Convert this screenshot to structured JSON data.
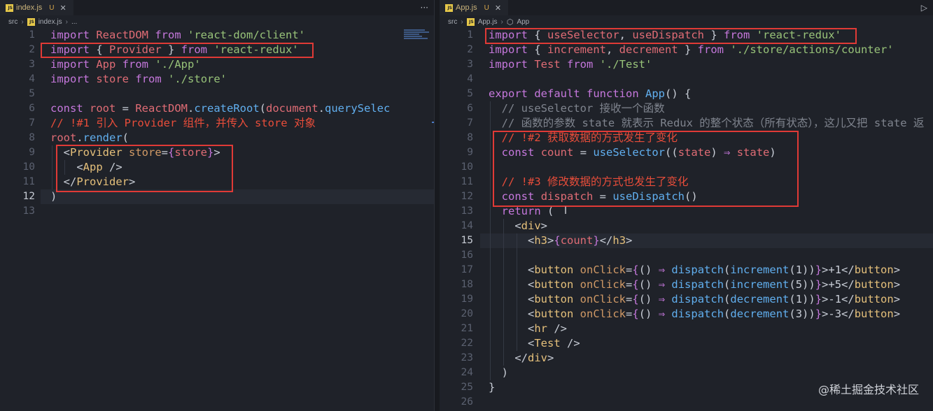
{
  "colors": {
    "kw": "#c678dd",
    "import_kw": "#c678dd",
    "id": "#e06c75",
    "str": "#98c379",
    "fn": "#61afef",
    "tag": "#e5c07b",
    "attr": "#d19a66",
    "comment": "#7f848e",
    "comment_cn": "#e84d3a",
    "punct": "#c8cdd6",
    "plain": "#c8cdd6",
    "var": "#e06c75"
  },
  "left": {
    "tab": {
      "icon": "js-icon",
      "filename": "index.js",
      "status": "U"
    },
    "more_label": "···",
    "breadcrumb": [
      "src",
      "index.js",
      "..."
    ],
    "active_line": 12,
    "lines": [
      {
        "n": "1",
        "tokens": [
          [
            "kw",
            "import"
          ],
          [
            "plain",
            " "
          ],
          [
            "id",
            "ReactDOM"
          ],
          [
            "plain",
            " "
          ],
          [
            "kw",
            "from"
          ],
          [
            "plain",
            " "
          ],
          [
            "str",
            "'react-dom/client'"
          ]
        ]
      },
      {
        "n": "2",
        "tokens": [
          [
            "kw",
            "import"
          ],
          [
            "plain",
            " { "
          ],
          [
            "id",
            "Provider"
          ],
          [
            "plain",
            " } "
          ],
          [
            "kw",
            "from"
          ],
          [
            "plain",
            " "
          ],
          [
            "str",
            "'react-redux'"
          ]
        ]
      },
      {
        "n": "3",
        "tokens": [
          [
            "kw",
            "import"
          ],
          [
            "plain",
            " "
          ],
          [
            "id",
            "App"
          ],
          [
            "plain",
            " "
          ],
          [
            "kw",
            "from"
          ],
          [
            "plain",
            " "
          ],
          [
            "str",
            "'./App'"
          ]
        ]
      },
      {
        "n": "4",
        "tokens": [
          [
            "kw",
            "import"
          ],
          [
            "plain",
            " "
          ],
          [
            "id",
            "store"
          ],
          [
            "plain",
            " "
          ],
          [
            "kw",
            "from"
          ],
          [
            "plain",
            " "
          ],
          [
            "str",
            "'./store'"
          ]
        ]
      },
      {
        "n": "5",
        "tokens": []
      },
      {
        "n": "6",
        "tokens": [
          [
            "kw",
            "const"
          ],
          [
            "plain",
            " "
          ],
          [
            "id",
            "root"
          ],
          [
            "plain",
            " = "
          ],
          [
            "id",
            "ReactDOM"
          ],
          [
            "plain",
            "."
          ],
          [
            "fn",
            "createRoot"
          ],
          [
            "plain",
            "("
          ],
          [
            "id",
            "document"
          ],
          [
            "plain",
            "."
          ],
          [
            "fn",
            "querySelec"
          ]
        ]
      },
      {
        "n": "7",
        "tokens": [
          [
            "comment_cn",
            "// !#1 引入 Provider 组件，并传入 store 对象"
          ]
        ]
      },
      {
        "n": "8",
        "tokens": [
          [
            "id",
            "root"
          ],
          [
            "plain",
            "."
          ],
          [
            "fn",
            "render"
          ],
          [
            "plain",
            "("
          ]
        ]
      },
      {
        "n": "9",
        "tokens": [
          [
            "plain",
            "  <"
          ],
          [
            "tag",
            "Provider"
          ],
          [
            "plain",
            " "
          ],
          [
            "attr",
            "store"
          ],
          [
            "plain",
            "="
          ],
          [
            "kw",
            "{"
          ],
          [
            "id",
            "store"
          ],
          [
            "kw",
            "}"
          ],
          [
            "plain",
            ">"
          ]
        ]
      },
      {
        "n": "10",
        "tokens": [
          [
            "plain",
            "    <"
          ],
          [
            "tag",
            "App"
          ],
          [
            "plain",
            " />"
          ]
        ]
      },
      {
        "n": "11",
        "tokens": [
          [
            "plain",
            "  </"
          ],
          [
            "tag",
            "Provider"
          ],
          [
            "plain",
            ">"
          ]
        ]
      },
      {
        "n": "12",
        "tokens": [
          [
            "plain",
            ")"
          ]
        ]
      },
      {
        "n": "13",
        "tokens": []
      }
    ]
  },
  "right": {
    "tab": {
      "icon": "js-icon",
      "filename": "App.js",
      "status": "U"
    },
    "breadcrumb": [
      "src",
      "App.js",
      "App"
    ],
    "active_line": 15,
    "lines": [
      {
        "n": "1",
        "tokens": [
          [
            "kw",
            "import"
          ],
          [
            "plain",
            " { "
          ],
          [
            "id",
            "useSelector"
          ],
          [
            "plain",
            ", "
          ],
          [
            "id",
            "useDispatch"
          ],
          [
            "plain",
            " } "
          ],
          [
            "kw",
            "from"
          ],
          [
            "plain",
            " "
          ],
          [
            "str",
            "'react-redux'"
          ]
        ]
      },
      {
        "n": "2",
        "tokens": [
          [
            "kw",
            "import"
          ],
          [
            "plain",
            " { "
          ],
          [
            "id",
            "increment"
          ],
          [
            "plain",
            ", "
          ],
          [
            "id",
            "decrement"
          ],
          [
            "plain",
            " } "
          ],
          [
            "kw",
            "from"
          ],
          [
            "plain",
            " "
          ],
          [
            "str",
            "'./store/actions/counter'"
          ]
        ]
      },
      {
        "n": "3",
        "tokens": [
          [
            "kw",
            "import"
          ],
          [
            "plain",
            " "
          ],
          [
            "id",
            "Test"
          ],
          [
            "plain",
            " "
          ],
          [
            "kw",
            "from"
          ],
          [
            "plain",
            " "
          ],
          [
            "str",
            "'./Test'"
          ]
        ]
      },
      {
        "n": "4",
        "tokens": []
      },
      {
        "n": "5",
        "tokens": [
          [
            "kw",
            "export"
          ],
          [
            "plain",
            " "
          ],
          [
            "kw",
            "default"
          ],
          [
            "plain",
            " "
          ],
          [
            "kw",
            "function"
          ],
          [
            "plain",
            " "
          ],
          [
            "fn",
            "App"
          ],
          [
            "plain",
            "() {"
          ]
        ]
      },
      {
        "n": "6",
        "tokens": [
          [
            "comment",
            "  // useSelector 接收一个函数"
          ]
        ]
      },
      {
        "n": "7",
        "tokens": [
          [
            "comment",
            "  // 函数的参数 state 就表示 Redux 的整个状态（所有状态），这儿又把 state 返"
          ]
        ]
      },
      {
        "n": "8",
        "tokens": [
          [
            "comment_cn",
            "  // !#2 获取数据的方式发生了变化"
          ]
        ]
      },
      {
        "n": "9",
        "tokens": [
          [
            "plain",
            "  "
          ],
          [
            "kw",
            "const"
          ],
          [
            "plain",
            " "
          ],
          [
            "id",
            "count"
          ],
          [
            "plain",
            " = "
          ],
          [
            "fn",
            "useSelector"
          ],
          [
            "plain",
            "(("
          ],
          [
            "id",
            "state"
          ],
          [
            "plain",
            ") "
          ],
          [
            "kw",
            "⇒"
          ],
          [
            "plain",
            " "
          ],
          [
            "id",
            "state"
          ],
          [
            "plain",
            ")"
          ]
        ]
      },
      {
        "n": "10",
        "tokens": []
      },
      {
        "n": "11",
        "tokens": [
          [
            "comment_cn",
            "  // !#3 修改数据的方式也发生了变化"
          ]
        ]
      },
      {
        "n": "12",
        "tokens": [
          [
            "plain",
            "  "
          ],
          [
            "kw",
            "const"
          ],
          [
            "plain",
            " "
          ],
          [
            "id",
            "dispatch"
          ],
          [
            "plain",
            " = "
          ],
          [
            "fn",
            "useDispatch"
          ],
          [
            "plain",
            "()"
          ]
        ]
      },
      {
        "n": "13",
        "tokens": [
          [
            "plain",
            "  "
          ],
          [
            "kw",
            "return"
          ],
          [
            "plain",
            " ("
          ]
        ]
      },
      {
        "n": "14",
        "tokens": [
          [
            "plain",
            "    <"
          ],
          [
            "tag",
            "div"
          ],
          [
            "plain",
            ">"
          ]
        ]
      },
      {
        "n": "15",
        "tokens": [
          [
            "plain",
            "      <"
          ],
          [
            "tag",
            "h3"
          ],
          [
            "plain",
            ">"
          ],
          [
            "kw",
            "{"
          ],
          [
            "id",
            "count"
          ],
          [
            "kw",
            "}"
          ],
          [
            "plain",
            "</"
          ],
          [
            "tag",
            "h3"
          ],
          [
            "plain",
            ">"
          ]
        ]
      },
      {
        "n": "16",
        "tokens": []
      },
      {
        "n": "17",
        "tokens": [
          [
            "plain",
            "      <"
          ],
          [
            "tag",
            "button"
          ],
          [
            "plain",
            " "
          ],
          [
            "attr",
            "onClick"
          ],
          [
            "plain",
            "="
          ],
          [
            "kw",
            "{"
          ],
          [
            "plain",
            "() "
          ],
          [
            "kw",
            "⇒"
          ],
          [
            "plain",
            " "
          ],
          [
            "fn",
            "dispatch"
          ],
          [
            "plain",
            "("
          ],
          [
            "fn",
            "increment"
          ],
          [
            "plain",
            "(1))"
          ],
          [
            "kw",
            "}"
          ],
          [
            "plain",
            ">+1</"
          ],
          [
            "tag",
            "button"
          ],
          [
            "plain",
            ">"
          ]
        ]
      },
      {
        "n": "18",
        "tokens": [
          [
            "plain",
            "      <"
          ],
          [
            "tag",
            "button"
          ],
          [
            "plain",
            " "
          ],
          [
            "attr",
            "onClick"
          ],
          [
            "plain",
            "="
          ],
          [
            "kw",
            "{"
          ],
          [
            "plain",
            "() "
          ],
          [
            "kw",
            "⇒"
          ],
          [
            "plain",
            " "
          ],
          [
            "fn",
            "dispatch"
          ],
          [
            "plain",
            "("
          ],
          [
            "fn",
            "increment"
          ],
          [
            "plain",
            "(5))"
          ],
          [
            "kw",
            "}"
          ],
          [
            "plain",
            ">+5</"
          ],
          [
            "tag",
            "button"
          ],
          [
            "plain",
            ">"
          ]
        ]
      },
      {
        "n": "19",
        "tokens": [
          [
            "plain",
            "      <"
          ],
          [
            "tag",
            "button"
          ],
          [
            "plain",
            " "
          ],
          [
            "attr",
            "onClick"
          ],
          [
            "plain",
            "="
          ],
          [
            "kw",
            "{"
          ],
          [
            "plain",
            "() "
          ],
          [
            "kw",
            "⇒"
          ],
          [
            "plain",
            " "
          ],
          [
            "fn",
            "dispatch"
          ],
          [
            "plain",
            "("
          ],
          [
            "fn",
            "decrement"
          ],
          [
            "plain",
            "(1))"
          ],
          [
            "kw",
            "}"
          ],
          [
            "plain",
            ">-1</"
          ],
          [
            "tag",
            "button"
          ],
          [
            "plain",
            ">"
          ]
        ]
      },
      {
        "n": "20",
        "tokens": [
          [
            "plain",
            "      <"
          ],
          [
            "tag",
            "button"
          ],
          [
            "plain",
            " "
          ],
          [
            "attr",
            "onClick"
          ],
          [
            "plain",
            "="
          ],
          [
            "kw",
            "{"
          ],
          [
            "plain",
            "() "
          ],
          [
            "kw",
            "⇒"
          ],
          [
            "plain",
            " "
          ],
          [
            "fn",
            "dispatch"
          ],
          [
            "plain",
            "("
          ],
          [
            "fn",
            "decrement"
          ],
          [
            "plain",
            "(3))"
          ],
          [
            "kw",
            "}"
          ],
          [
            "plain",
            ">-3</"
          ],
          [
            "tag",
            "button"
          ],
          [
            "plain",
            ">"
          ]
        ]
      },
      {
        "n": "21",
        "tokens": [
          [
            "plain",
            "      <"
          ],
          [
            "tag",
            "hr"
          ],
          [
            "plain",
            " />"
          ]
        ]
      },
      {
        "n": "22",
        "tokens": [
          [
            "plain",
            "      <"
          ],
          [
            "tag",
            "Test"
          ],
          [
            "plain",
            " />"
          ]
        ]
      },
      {
        "n": "23",
        "tokens": [
          [
            "plain",
            "    </"
          ],
          [
            "tag",
            "div"
          ],
          [
            "plain",
            ">"
          ]
        ]
      },
      {
        "n": "24",
        "tokens": [
          [
            "plain",
            "  )"
          ]
        ]
      },
      {
        "n": "25",
        "tokens": [
          [
            "plain",
            "}"
          ]
        ]
      },
      {
        "n": "26",
        "tokens": []
      }
    ]
  },
  "watermark": "@稀土掘金技术社区"
}
